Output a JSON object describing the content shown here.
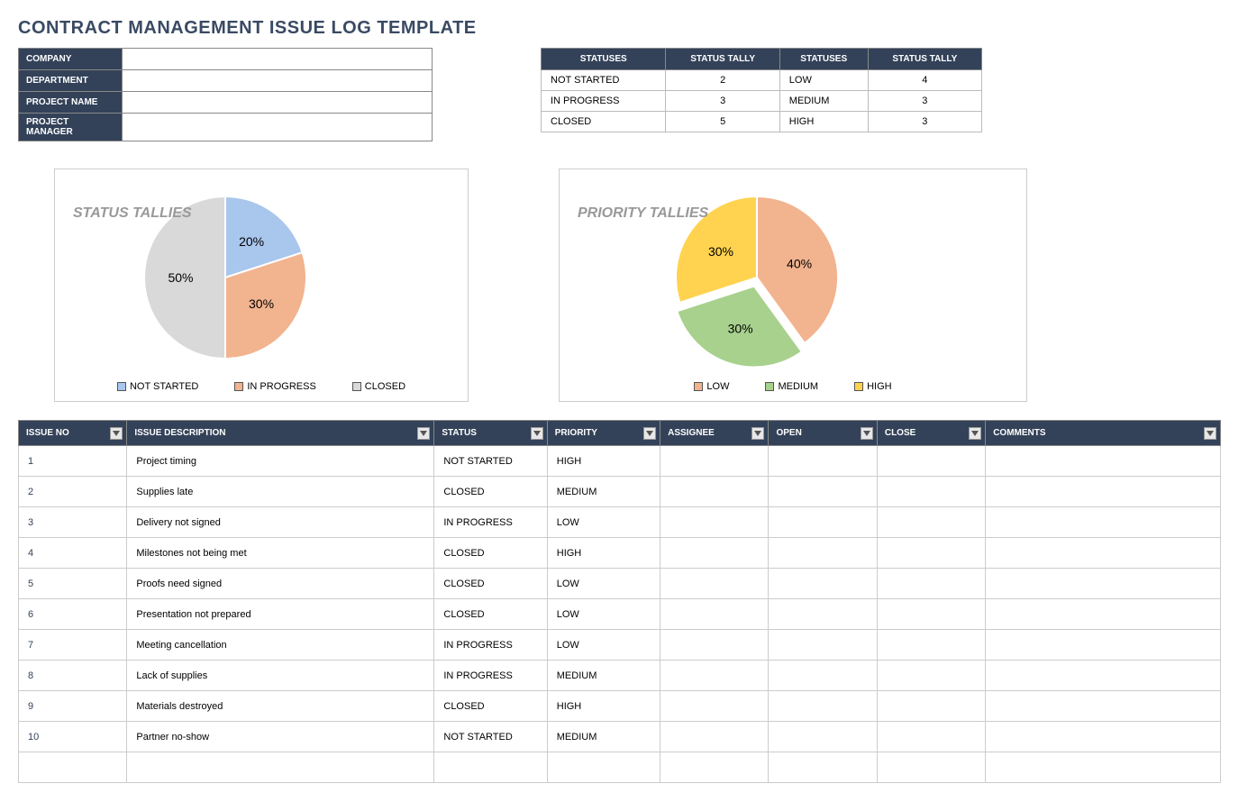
{
  "title": "CONTRACT MANAGEMENT ISSUE LOG TEMPLATE",
  "meta_fields": [
    {
      "label": "COMPANY",
      "value": ""
    },
    {
      "label": "DEPARTMENT",
      "value": ""
    },
    {
      "label": "PROJECT NAME",
      "value": ""
    },
    {
      "label": "PROJECT MANAGER",
      "value": ""
    }
  ],
  "tally_headers": [
    "STATUSES",
    "STATUS TALLY",
    "STATUSES",
    "STATUS TALLY"
  ],
  "tally_rows": [
    {
      "s1": "NOT STARTED",
      "t1": "2",
      "s2": "LOW",
      "t2": "4"
    },
    {
      "s1": "IN PROGRESS",
      "t1": "3",
      "s2": "MEDIUM",
      "t2": "3"
    },
    {
      "s1": "CLOSED",
      "t1": "5",
      "s2": "HIGH",
      "t2": "3"
    }
  ],
  "chart_data": [
    {
      "type": "pie",
      "title": "STATUS TALLIES",
      "series": [
        {
          "name": "NOT STARTED",
          "value": 20,
          "label": "20%",
          "color": "#a9c6ec"
        },
        {
          "name": "IN PROGRESS",
          "value": 30,
          "label": "30%",
          "color": "#f2b38f"
        },
        {
          "name": "CLOSED",
          "value": 50,
          "label": "50%",
          "color": "#d9d9d9"
        }
      ]
    },
    {
      "type": "pie",
      "title": "PRIORITY TALLIES",
      "series": [
        {
          "name": "LOW",
          "value": 40,
          "label": "40%",
          "color": "#f2b38f"
        },
        {
          "name": "MEDIUM",
          "value": 30,
          "label": "30%",
          "color": "#a8d18d"
        },
        {
          "name": "HIGH",
          "value": 30,
          "label": "30%",
          "color": "#ffd34f"
        }
      ]
    }
  ],
  "issues_headers": [
    "ISSUE NO",
    "ISSUE DESCRIPTION",
    "STATUS",
    "PRIORITY",
    "ASSIGNEE",
    "OPEN",
    "CLOSE",
    "COMMENTS"
  ],
  "issues": [
    {
      "no": "1",
      "desc": "Project timing",
      "status": "NOT STARTED",
      "priority": "HIGH",
      "assignee": "",
      "open": "",
      "close": "",
      "comments": ""
    },
    {
      "no": "2",
      "desc": "Supplies late",
      "status": "CLOSED",
      "priority": "MEDIUM",
      "assignee": "",
      "open": "",
      "close": "",
      "comments": ""
    },
    {
      "no": "3",
      "desc": "Delivery not signed",
      "status": "IN PROGRESS",
      "priority": "LOW",
      "assignee": "",
      "open": "",
      "close": "",
      "comments": ""
    },
    {
      "no": "4",
      "desc": "Milestones not being met",
      "status": "CLOSED",
      "priority": "HIGH",
      "assignee": "",
      "open": "",
      "close": "",
      "comments": ""
    },
    {
      "no": "5",
      "desc": "Proofs need signed",
      "status": "CLOSED",
      "priority": "LOW",
      "assignee": "",
      "open": "",
      "close": "",
      "comments": ""
    },
    {
      "no": "6",
      "desc": "Presentation not prepared",
      "status": "CLOSED",
      "priority": "LOW",
      "assignee": "",
      "open": "",
      "close": "",
      "comments": ""
    },
    {
      "no": "7",
      "desc": "Meeting cancellation",
      "status": "IN PROGRESS",
      "priority": "LOW",
      "assignee": "",
      "open": "",
      "close": "",
      "comments": ""
    },
    {
      "no": "8",
      "desc": "Lack of supplies",
      "status": "IN PROGRESS",
      "priority": "MEDIUM",
      "assignee": "",
      "open": "",
      "close": "",
      "comments": ""
    },
    {
      "no": "9",
      "desc": "Materials destroyed",
      "status": "CLOSED",
      "priority": "HIGH",
      "assignee": "",
      "open": "",
      "close": "",
      "comments": ""
    },
    {
      "no": "10",
      "desc": "Partner no-show",
      "status": "NOT STARTED",
      "priority": "MEDIUM",
      "assignee": "",
      "open": "",
      "close": "",
      "comments": ""
    },
    {
      "no": "",
      "desc": "",
      "status": "",
      "priority": "",
      "assignee": "",
      "open": "",
      "close": "",
      "comments": ""
    }
  ],
  "col_widths": [
    "120",
    "340",
    "125",
    "125",
    "120",
    "120",
    "120",
    "260"
  ]
}
